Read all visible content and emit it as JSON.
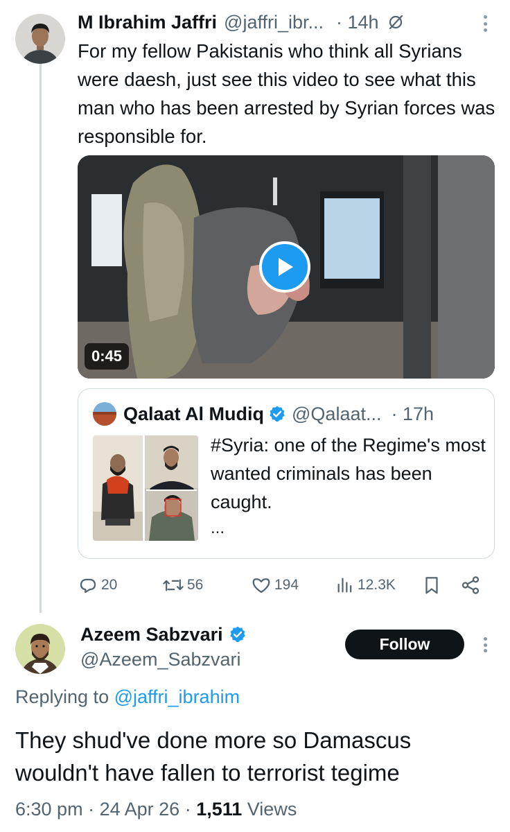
{
  "tweet": {
    "author_name": "M Ibrahim Jaffri",
    "author_handle": "@jaffri_ibr...",
    "time": "· 14h",
    "text": "For my fellow Pakistanis who think all Syrians were daesh, just see this video to see what this man who has been arrested by Syrian forces was responsible for.",
    "video_duration": "0:45",
    "quote": {
      "author_name": "Qalaat Al Mudiq",
      "author_handle": "@Qalaat...",
      "time": "· 17h",
      "text": "#Syria: one of the Regime's most wanted criminals has been caught.",
      "more": "..."
    },
    "stats": {
      "replies": "20",
      "reposts": "56",
      "likes": "194",
      "views": "12.3K"
    }
  },
  "reply": {
    "author_name": "Azeem Sabzvari",
    "author_handle": "@Azeem_Sabzvari",
    "follow_label": "Follow",
    "replying_prefix": "Replying to",
    "replying_to": "@jaffri_ibrahim",
    "text": "They shud've done more so Damascus wouldn't have fallen to terrorist tegime",
    "time": "6:30 pm",
    "date": "24 Apr 26",
    "views_count": "1,511",
    "views_label": "Views"
  },
  "icons": {
    "verified": "verified-badge-icon",
    "grok": "grok-icon",
    "reply": "reply-icon",
    "repost": "repost-icon",
    "like": "like-icon",
    "views": "views-icon",
    "bookmark": "bookmark-icon",
    "share": "share-icon",
    "more": "more-icon",
    "play": "play-icon"
  },
  "colors": {
    "accent": "#1d9bf0",
    "text": "#0f1419",
    "secondary": "#536471",
    "border": "#cfd9de",
    "follow_bg": "#0f1419"
  }
}
